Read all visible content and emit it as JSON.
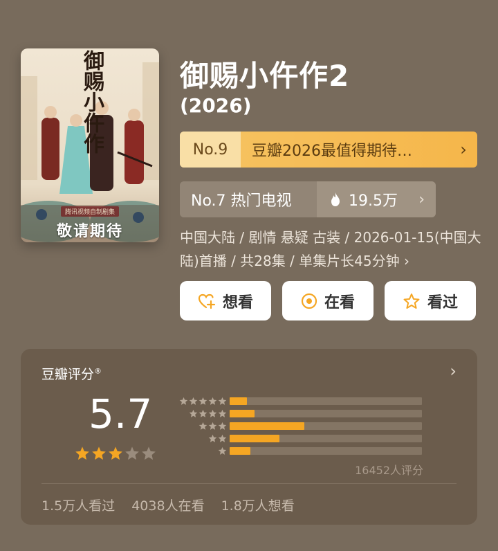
{
  "poster": {
    "vertical_title": "御赐小仵作",
    "badge": "腾讯视频自制剧集",
    "slogan": "敬请期待"
  },
  "title": "御赐小仵作2",
  "year": "(2026)",
  "rank": {
    "no": "No.9",
    "label": "豆瓣2026最值得期待…",
    "chev": "›"
  },
  "hot": {
    "no_label": "No.7 热门电视",
    "heat": "19.5万",
    "chev": "›"
  },
  "meta": "中国大陆 / 剧情 悬疑 古装 / 2026-01-15(中国大陆)首播 / 共28集 / 单集片长45分钟 ›",
  "actions": [
    {
      "label": "想看",
      "icon": "heart-plus-icon"
    },
    {
      "label": "在看",
      "icon": "target-icon"
    },
    {
      "label": "看过",
      "icon": "star-outline-icon"
    }
  ],
  "rating": {
    "title": "豆瓣评分",
    "mark": "®",
    "chev": "›",
    "score": "5.7",
    "stars_filled": 3,
    "stars_total": 5,
    "distribution": [
      {
        "stars": 5,
        "fraction": 0.09
      },
      {
        "stars": 4,
        "fraction": 0.13
      },
      {
        "stars": 3,
        "fraction": 0.39
      },
      {
        "stars": 2,
        "fraction": 0.26
      },
      {
        "stars": 1,
        "fraction": 0.11
      }
    ],
    "count": "16452人评分",
    "stats": [
      "1.5万人看过",
      "4038人在看",
      "1.8万人想看"
    ]
  },
  "colors": {
    "accent": "#f5a623",
    "page_bg": "#786b5c",
    "card_bg": "#6b5c4c"
  }
}
